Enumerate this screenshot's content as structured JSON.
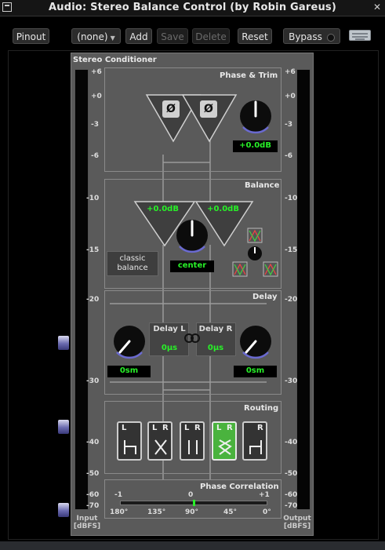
{
  "window": {
    "title": "Audio: Stereo Balance Control (by Robin Gareus)"
  },
  "toolbar": {
    "pinout": "Pinout",
    "preset": "(none)",
    "add": "Add",
    "save": "Save",
    "delete": "Delete",
    "reset": "Reset",
    "bypass": "Bypass"
  },
  "plugin": {
    "title": "Stereo Conditioner",
    "phase_trim": {
      "title": "Phase & Trim",
      "phase_left": "Ø",
      "phase_right": "Ø",
      "trim_value": "+0.0dB"
    },
    "balance": {
      "title": "Balance",
      "gain_left": "+0.0dB",
      "gain_right": "+0.0dB",
      "mode_line1": "classic",
      "mode_line2": "balance",
      "position": "center"
    },
    "delay": {
      "title": "Delay",
      "left_label": "Delay L",
      "right_label": "Delay R",
      "left_time": "0µs",
      "right_time": "0µs",
      "left_distance": "0sm",
      "right_distance": "0sm",
      "link_icon": "link-icon"
    },
    "routing": {
      "title": "Routing",
      "selected_index": 3,
      "buttons": [
        {
          "l": "L",
          "r": ""
        },
        {
          "l": "L",
          "r": "R"
        },
        {
          "l": "L",
          "r": "R"
        },
        {
          "l": "L",
          "r": "R"
        },
        {
          "l": "",
          "r": "R"
        }
      ]
    },
    "correlation": {
      "title": "Phase Correlation",
      "value": 0.0,
      "top_labels": [
        "-1",
        "0",
        "+1"
      ],
      "bottom_labels": [
        "180°",
        "135°",
        "90°",
        "45°",
        "0°"
      ]
    },
    "input_meter": {
      "label_line1": "Input",
      "label_line2": "[dBFS]"
    },
    "output_meter": {
      "label_line1": "Output",
      "label_line2": "[dBFS]"
    },
    "scale_labels": [
      "+6",
      "+0",
      "-3",
      "-6",
      "-10",
      "-15",
      "-20",
      "-30",
      "-40",
      "-50",
      "-60",
      "-70"
    ]
  },
  "colors": {
    "accent_green": "#28f028",
    "routing_selected": "#4ab33e",
    "panel_bg": "#5a5a5a"
  }
}
